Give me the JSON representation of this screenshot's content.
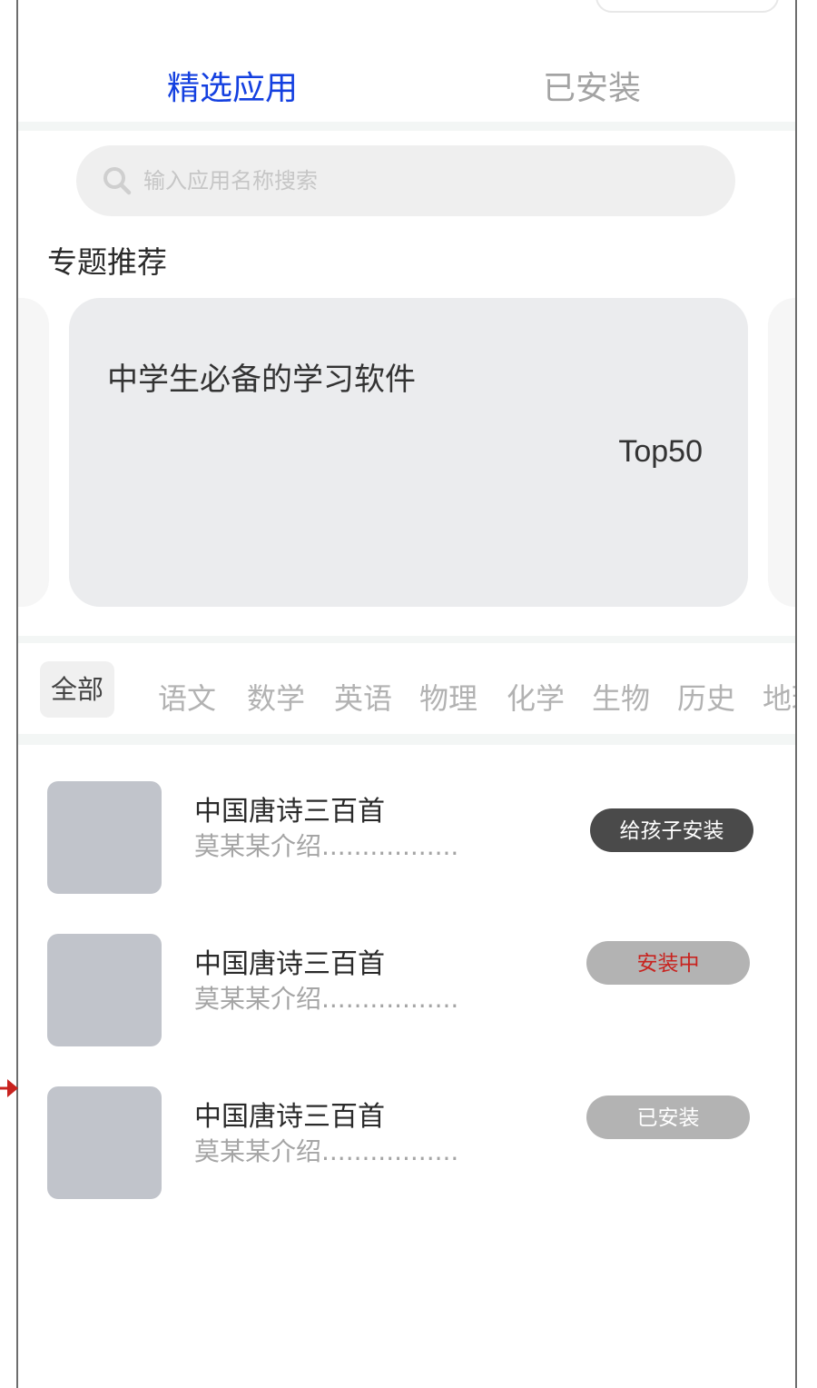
{
  "tabs": [
    {
      "label": "精选应用",
      "active": true
    },
    {
      "label": "已安装",
      "active": false
    }
  ],
  "search": {
    "placeholder": "输入应用名称搜索"
  },
  "featured": {
    "section_title": "专题推荐",
    "card": {
      "title": "中学生必备的学习软件",
      "badge": "Top50"
    }
  },
  "categories": [
    "全部",
    "语文",
    "数学",
    "英语",
    "物理",
    "化学",
    "生物",
    "历史",
    "地理"
  ],
  "apps": [
    {
      "name": "中国唐诗三百首",
      "desc": "莫某某介绍.................",
      "action": "给孩子安装"
    },
    {
      "name": "中国唐诗三百首",
      "desc": "莫某某介绍.................",
      "action": "安装中"
    },
    {
      "name": "中国唐诗三百首",
      "desc": "莫某某介绍.................",
      "action": "已安装"
    }
  ],
  "colors": {
    "accent": "#1440e0",
    "installing_text": "#c8231f",
    "dark_button": "#4a4a4a",
    "gray_button": "#b3b3b3",
    "icon_placeholder": "#c1c4cb"
  }
}
